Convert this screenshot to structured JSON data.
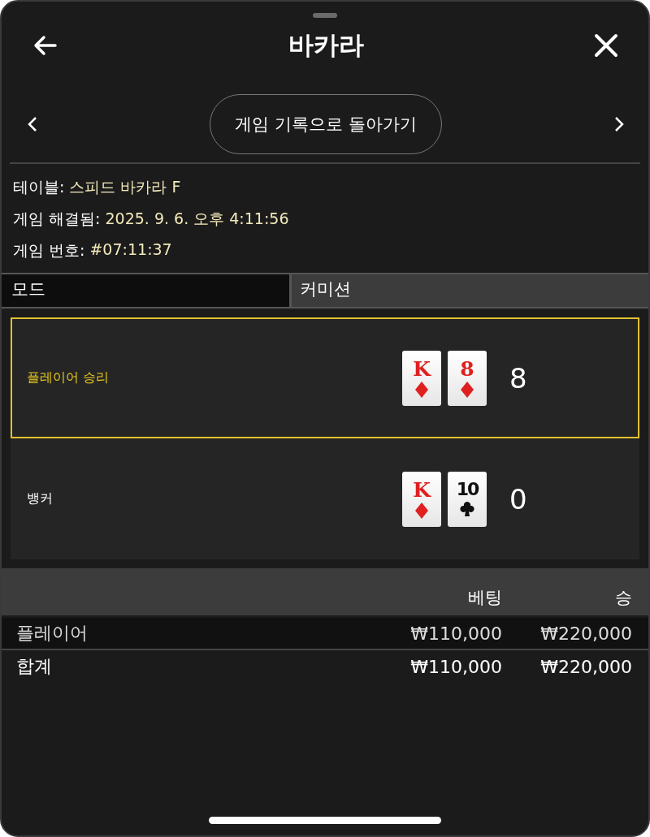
{
  "header": {
    "title": "바카라"
  },
  "nav": {
    "button": "게임 기록으로 돌아가기"
  },
  "info": [
    {
      "label": "테이블:",
      "value": "스피드 바카라 F"
    },
    {
      "label": "게임 해결됨:",
      "value": "2025. 9. 6. 오후 4:11:56"
    },
    {
      "label": "게임 번호:",
      "value": "#07:11:37"
    }
  ],
  "mode": {
    "label": "모드",
    "value": "커미션"
  },
  "hands": [
    {
      "name": "플레이어 승리",
      "winner": true,
      "score": "8",
      "cards": [
        {
          "rank": "K",
          "kind": "diamond"
        },
        {
          "rank": "8",
          "kind": "diamond"
        }
      ]
    },
    {
      "name": "뱅커",
      "winner": false,
      "score": "0",
      "cards": [
        {
          "rank": "K",
          "kind": "diamond"
        },
        {
          "rank": "10",
          "kind": "club"
        }
      ]
    }
  ],
  "bets": {
    "columns": [
      "베팅",
      "승"
    ],
    "rows": [
      {
        "kind": "bet",
        "label": "플레이어",
        "bet": "₩110,000",
        "win": "₩220,000"
      },
      {
        "kind": "total",
        "label": "합계",
        "bet": "₩110,000",
        "win": "₩220,000"
      }
    ]
  }
}
